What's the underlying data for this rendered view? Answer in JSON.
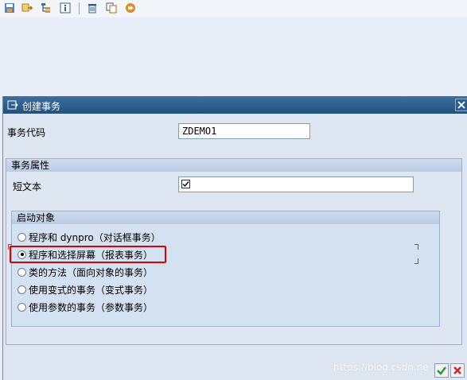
{
  "toolbar": {
    "icons": [
      "save-local-icon",
      "expand-icon",
      "hierarchy-icon",
      "info-icon",
      "delete-icon",
      "copy-icon",
      "execute-icon"
    ]
  },
  "dialog": {
    "title": "创建事务",
    "tx_code_label": "事务代码",
    "tx_code_value": "ZDEMO1",
    "attributes": {
      "title": "事务属性",
      "short_text_label": "短文本",
      "short_text_value": ""
    },
    "start_object": {
      "title": "启动对象",
      "options": [
        {
          "label": "程序和 dynpro（对话框事务）",
          "selected": false
        },
        {
          "label": "程序和选择屏幕（报表事务）",
          "selected": true
        },
        {
          "label": "类的方法（面向对象的事务）",
          "selected": false
        },
        {
          "label": "使用变式的事务（变式事务）",
          "selected": false
        },
        {
          "label": "使用参数的事务（参数事务）",
          "selected": false
        }
      ]
    }
  },
  "watermark": "https://blog.csdn.ne",
  "colors": {
    "titlebar": "#2b5b88",
    "highlight": "#e00000",
    "ok": "#1f9a2e",
    "cancel": "#d02020"
  }
}
